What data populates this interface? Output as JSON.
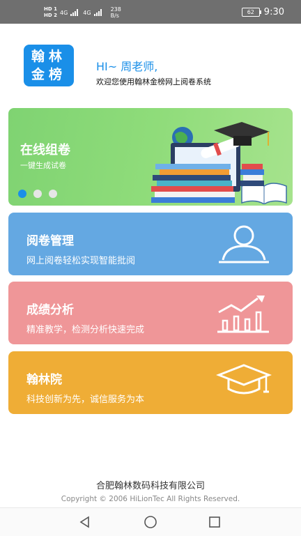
{
  "status_bar": {
    "hd1": "HD 1",
    "hd2": "HD 2",
    "net1": "4G",
    "net2": "4G",
    "speed_value": "238",
    "speed_unit": "B/s",
    "battery": "62",
    "time": "9:30"
  },
  "header": {
    "logo_line1": "翰林",
    "logo_line2": "金榜",
    "greeting": "HI~ 周老师,",
    "welcome": "欢迎您使用翰林金榜网上阅卷系统"
  },
  "banner": {
    "title": "在线组卷",
    "subtitle": "一键生成试卷",
    "slide_count": 3,
    "active_slide": 1
  },
  "cards": [
    {
      "title": "阅卷管理",
      "subtitle": "网上阅卷轻松实现智能批阅",
      "icon": "user-icon",
      "color": "#64a8e2"
    },
    {
      "title": "成绩分析",
      "subtitle": "精准教学，检测分析快速完成",
      "icon": "bar-chart-icon",
      "color": "#ef9698"
    },
    {
      "title": "翰林院",
      "subtitle": "科技创新为先，诚信服务为本",
      "icon": "graduation-cap-icon",
      "color": "#efad36"
    }
  ],
  "footer": {
    "company": "合肥翰林数码科技有限公司",
    "copyright": "Copyright © 2006  HiLionTec All Rights Reserved."
  },
  "navbar": {
    "back": "back-icon",
    "home": "home-icon",
    "recents": "recents-icon"
  }
}
